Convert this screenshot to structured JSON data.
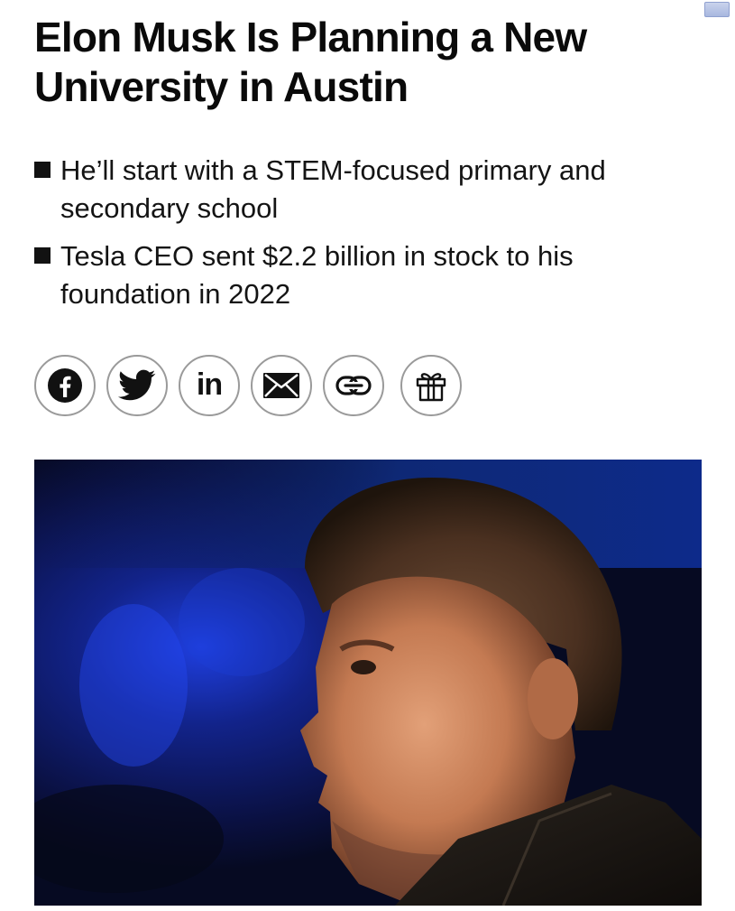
{
  "article": {
    "headline": "Elon Musk Is Planning a New University in Austin",
    "bullets": [
      "He’ll start with a STEM-focused primary and secondary school",
      "Tesla CEO sent $2.2 billion in stock to his foundation in 2022"
    ]
  },
  "share": {
    "buttons": [
      {
        "icon": "facebook-icon"
      },
      {
        "icon": "twitter-icon"
      },
      {
        "icon": "linkedin-icon",
        "text": "in"
      },
      {
        "icon": "email-icon"
      },
      {
        "icon": "link-icon"
      },
      {
        "icon": "gift-icon"
      }
    ]
  },
  "photo": {
    "subject": "portrait",
    "background_color": "#0b1238",
    "accent_color": "#1a3ad8"
  },
  "colors": {
    "text": "#0a0a0a",
    "button_border": "#9a9a9a"
  }
}
